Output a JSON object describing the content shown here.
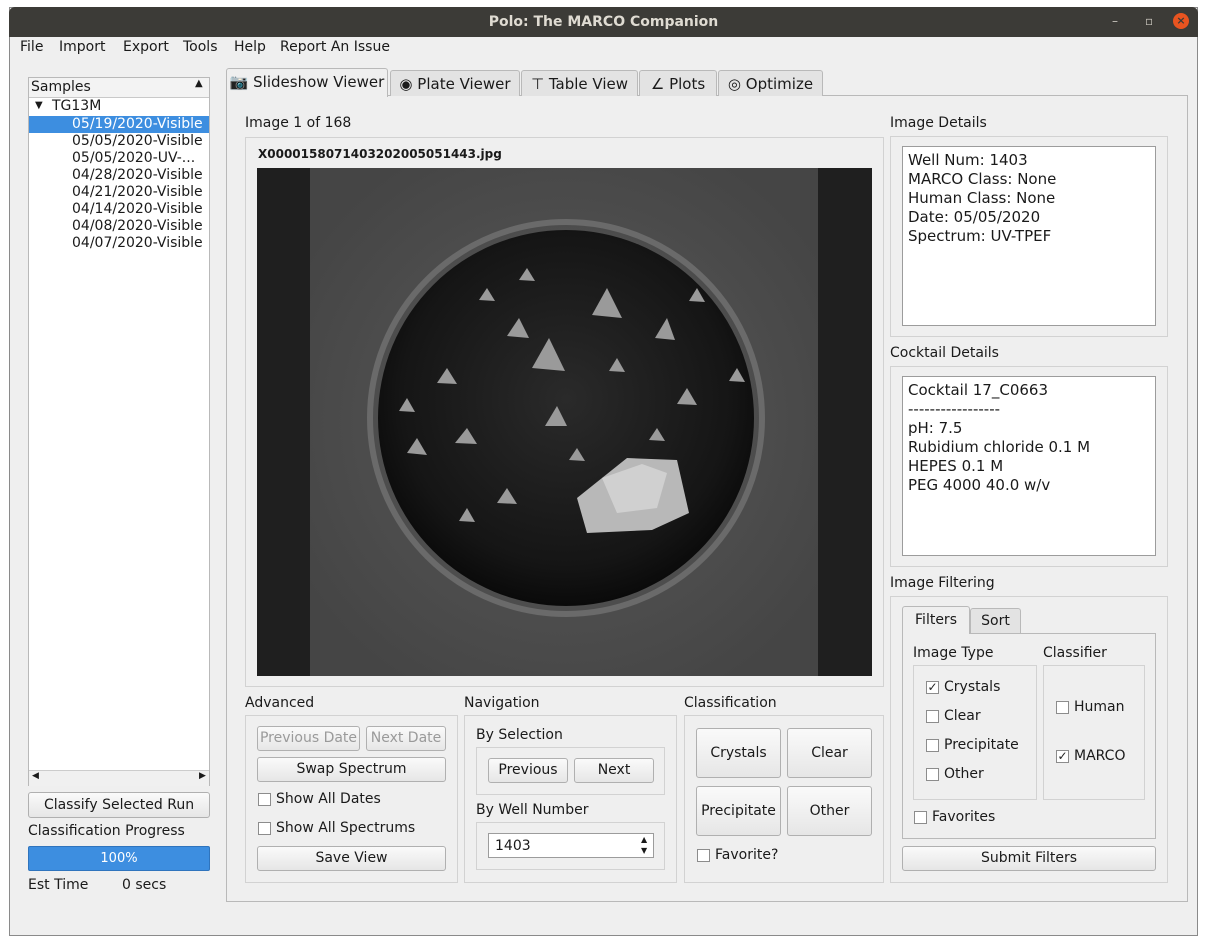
{
  "window": {
    "title": "Polo: The MARCO Companion",
    "minimize": "–",
    "maximize": "▫",
    "close": "×"
  },
  "menu": [
    "File",
    "Import",
    "Export",
    "Tools",
    "Help",
    "Report An Issue"
  ],
  "samples": {
    "header": "Samples",
    "root": "TG13M",
    "items": [
      "05/19/2020-Visible",
      "05/05/2020-Visible",
      "05/05/2020-UV-...",
      "04/28/2020-Visible",
      "04/21/2020-Visible",
      "04/14/2020-Visible",
      "04/08/2020-Visible",
      "04/07/2020-Visible"
    ],
    "selected_index": 0
  },
  "left_bottom": {
    "classify_button": "Classify Selected Run",
    "progress_label": "Classification Progress",
    "progress_value": 1.0,
    "progress_text": "100%",
    "est_time_label": "Est Time",
    "est_time_value": "0 secs"
  },
  "tabs": [
    {
      "label": "Slideshow Viewer",
      "icon": "camera-icon",
      "active": true
    },
    {
      "label": "Plate Viewer",
      "icon": "eye-icon",
      "active": false
    },
    {
      "label": "Table View",
      "icon": "table-icon",
      "active": false
    },
    {
      "label": "Plots",
      "icon": "chart-icon",
      "active": false
    },
    {
      "label": "Optimize",
      "icon": "target-icon",
      "active": false
    }
  ],
  "viewer": {
    "image_counter": "Image 1 of 168",
    "filename": "X0000158071403202005051443.jpg"
  },
  "image_details": {
    "title": "Image Details",
    "lines": [
      "Well Num: 1403",
      "MARCO Class: None",
      "Human Class: None",
      "Date: 05/05/2020",
      "Spectrum: UV-TPEF"
    ]
  },
  "cocktail_details": {
    "title": "Cocktail Details",
    "lines": [
      "Cocktail 17_C0663",
      "-----------------",
      "pH: 7.5",
      "Rubidium chloride 0.1 M",
      "HEPES 0.1 M",
      "PEG 4000 40.0 w/v"
    ]
  },
  "advanced": {
    "title": "Advanced",
    "prev_date": "Previous Date",
    "next_date": "Next Date",
    "swap_spectrum": "Swap Spectrum",
    "show_all_dates": "Show All Dates",
    "show_all_spectrums": "Show All Spectrums",
    "save_view": "Save View"
  },
  "navigation": {
    "title": "Navigation",
    "by_selection": "By Selection",
    "previous": "Previous",
    "next": "Next",
    "by_well_number": "By Well Number",
    "well_value": "1403"
  },
  "classification": {
    "title": "Classification",
    "crystals": "Crystals",
    "clear": "Clear",
    "precipitate": "Precipitate",
    "other": "Other",
    "favorite": "Favorite?"
  },
  "filtering": {
    "title": "Image Filtering",
    "tab_filters": "Filters",
    "tab_sort": "Sort",
    "image_type_title": "Image Type",
    "classifier_title": "Classifier",
    "crystals": "Crystals",
    "clear": "Clear",
    "precipitate": "Precipitate",
    "other": "Other",
    "human": "Human",
    "marco": "MARCO",
    "favorites": "Favorites",
    "submit": "Submit Filters",
    "checked": {
      "crystals": true,
      "clear": false,
      "precipitate": false,
      "other": false,
      "human": false,
      "marco": true,
      "favorites": false
    }
  }
}
